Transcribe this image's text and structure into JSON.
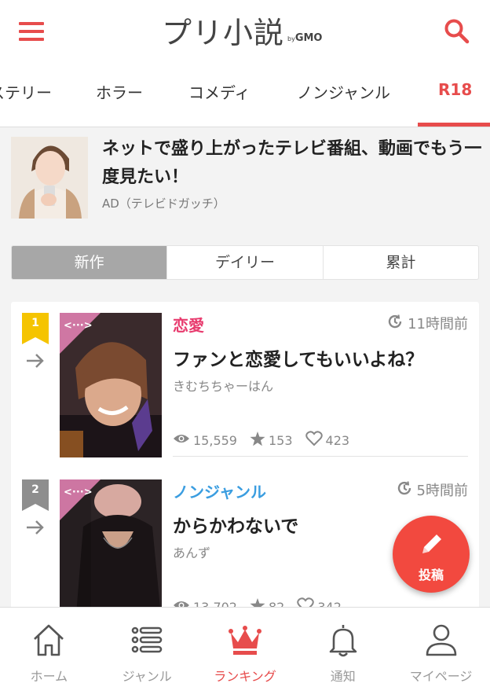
{
  "header": {
    "logo_main": "プリ小説",
    "logo_by": "by",
    "logo_brand": "GMO"
  },
  "genre_tabs": [
    "ステリー",
    "ホラー",
    "コメディ",
    "ノンジャンル",
    "R18"
  ],
  "ad": {
    "title": "ネットで盛り上がったテレビ番組、動画でもう一度見たい！",
    "source": "AD（テレビドガッチ）"
  },
  "ranking_tabs": [
    "新作",
    "デイリー",
    "累計"
  ],
  "ranking_tab_active": "新作",
  "items": [
    {
      "rank": "1",
      "genre": "恋愛",
      "genre_color": "#e83b6e",
      "time": "11時間前",
      "title": "ファンと恋愛してもいいよね？",
      "author": "きむちちゃーはん",
      "views": "15,559",
      "stars": "153",
      "likes": "423",
      "badge_color": "#f5c400",
      "cover_tag": "<···>"
    },
    {
      "rank": "2",
      "genre": "ノンジャンル",
      "genre_color": "#3a9de0",
      "time": "5時間前",
      "title": "からかわないで",
      "author": "あんず",
      "views": "13,702",
      "stars": "82",
      "likes": "342",
      "badge_color": "#8e8e8e",
      "cover_tag": "<···>"
    }
  ],
  "fab": {
    "label": "投稿"
  },
  "bottom_nav": [
    {
      "label": "ホーム",
      "icon": "home-icon"
    },
    {
      "label": "ジャンル",
      "icon": "list-icon"
    },
    {
      "label": "ランキング",
      "icon": "crown-icon"
    },
    {
      "label": "通知",
      "icon": "bell-icon"
    },
    {
      "label": "マイページ",
      "icon": "user-icon"
    }
  ],
  "colors": {
    "accent": "#e74c4c",
    "fab": "#f2493f",
    "segment_active": "#a7a7a7"
  }
}
